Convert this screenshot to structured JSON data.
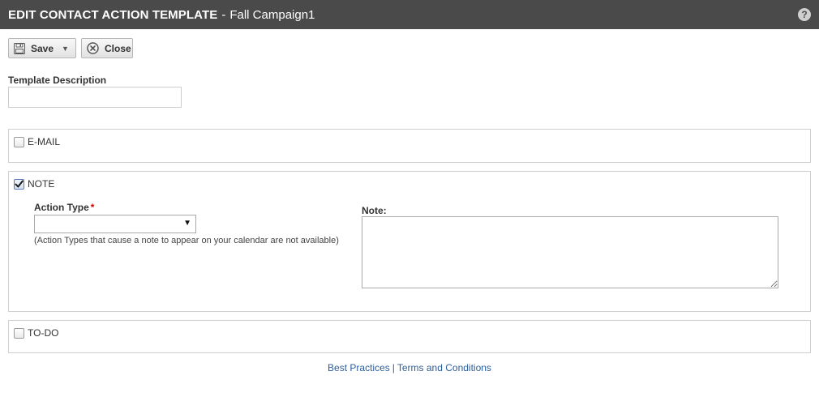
{
  "header": {
    "title_strong": "EDIT CONTACT ACTION TEMPLATE",
    "separator": "-",
    "campaign_name": "Fall Campaign1",
    "help_icon": "?",
    "bg_color": "#4a4a4a"
  },
  "toolbar": {
    "save_label": "Save",
    "save_icon": "floppy-disk-icon",
    "save_caret_icon": "caret-down-icon",
    "close_label": "Close",
    "close_icon": "close-circle-icon"
  },
  "template_description": {
    "label": "Template Description",
    "value": ""
  },
  "sections": {
    "email": {
      "label": "E-MAIL",
      "checked": false
    },
    "note": {
      "label": "NOTE",
      "checked": true,
      "action_type_label": "Action Type",
      "required_marker": "*",
      "action_type_value": "",
      "action_type_hint": "(Action Types that cause a note to appear on your calendar are not available)",
      "note_label": "Note:",
      "note_value": ""
    },
    "todo": {
      "label": "TO-DO",
      "checked": false
    }
  },
  "footer": {
    "best_practices": "Best Practices",
    "separator": "|",
    "terms": "Terms and Conditions",
    "link_color": "#2b5e9e"
  }
}
